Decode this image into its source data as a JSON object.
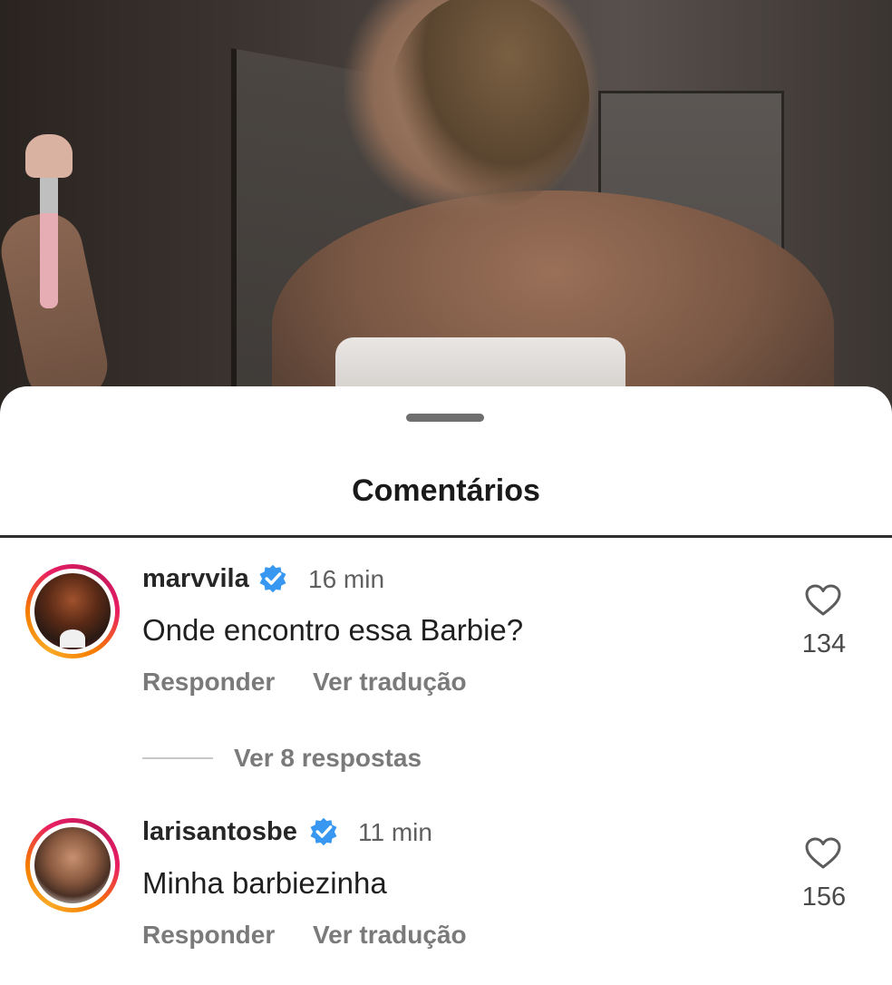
{
  "sheet": {
    "title": "Comentários"
  },
  "comments": [
    {
      "username": "marvvila",
      "verified": true,
      "time": "16 min",
      "text": "Onde encontro essa Barbie?",
      "likes": "134",
      "reply_label": "Responder",
      "translate_label": "Ver tradução",
      "view_replies_label": "Ver 8 respostas"
    },
    {
      "username": "larisantosbe",
      "verified": true,
      "time": "11 min",
      "text": "Minha barbiezinha",
      "likes": "156",
      "reply_label": "Responder",
      "translate_label": "Ver tradução"
    }
  ],
  "colors": {
    "verified_badge": "#3897f0",
    "story_ring_start": "#f9a825",
    "story_ring_end": "#c2185b"
  },
  "icons": {
    "like": "heart-outline-icon",
    "verified": "verified-badge-icon"
  }
}
